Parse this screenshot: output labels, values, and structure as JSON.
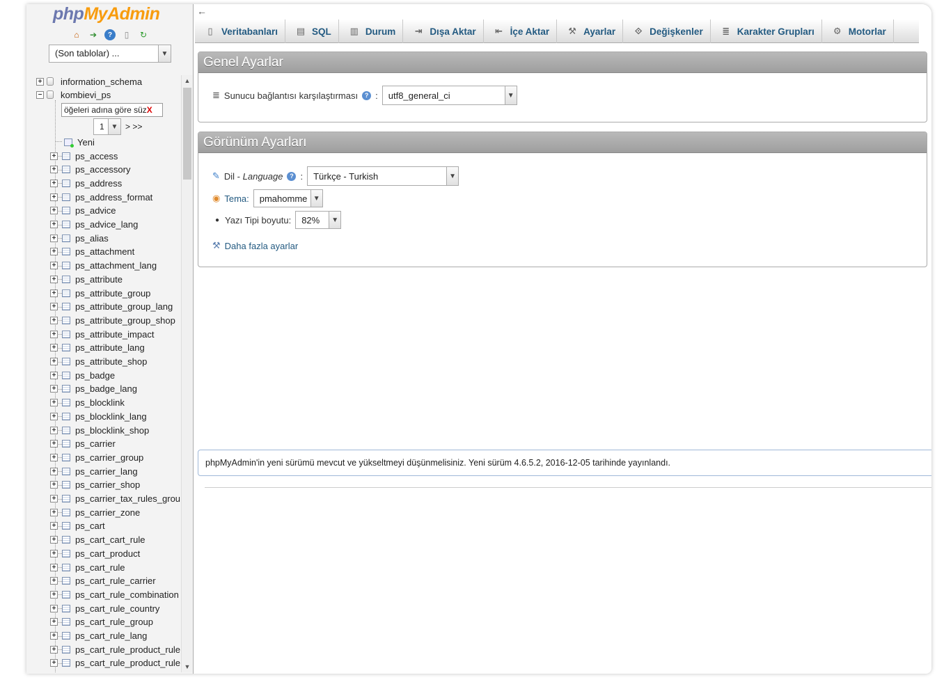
{
  "logo": {
    "php": "php",
    "my": "My",
    "admin": "Admin"
  },
  "nav": {
    "recent_select": "(Son tablolar) ...",
    "databases": [
      {
        "name": "information_schema",
        "expanded": false
      },
      {
        "name": "kombievi_ps",
        "expanded": true
      }
    ],
    "filter_placeholder": "öğeleri adına göre süz",
    "filter_clear": "X",
    "page_value": "1",
    "page_next": "> >>",
    "new_label": "Yeni",
    "tables": [
      "ps_access",
      "ps_accessory",
      "ps_address",
      "ps_address_format",
      "ps_advice",
      "ps_advice_lang",
      "ps_alias",
      "ps_attachment",
      "ps_attachment_lang",
      "ps_attribute",
      "ps_attribute_group",
      "ps_attribute_group_lang",
      "ps_attribute_group_shop",
      "ps_attribute_impact",
      "ps_attribute_lang",
      "ps_attribute_shop",
      "ps_badge",
      "ps_badge_lang",
      "ps_blocklink",
      "ps_blocklink_lang",
      "ps_blocklink_shop",
      "ps_carrier",
      "ps_carrier_group",
      "ps_carrier_lang",
      "ps_carrier_shop",
      "ps_carrier_tax_rules_grou",
      "ps_carrier_zone",
      "ps_cart",
      "ps_cart_cart_rule",
      "ps_cart_product",
      "ps_cart_rule",
      "ps_cart_rule_carrier",
      "ps_cart_rule_combination",
      "ps_cart_rule_country",
      "ps_cart_rule_group",
      "ps_cart_rule_lang",
      "ps_cart_rule_product_rule",
      "ps_cart_rule_product_rule"
    ]
  },
  "tabs": [
    {
      "label": "Veritabanları",
      "icon": "database-icon",
      "glyph": "▯"
    },
    {
      "label": "SQL",
      "icon": "sql-icon",
      "glyph": "▤"
    },
    {
      "label": "Durum",
      "icon": "status-icon",
      "glyph": "▥"
    },
    {
      "label": "Dışa Aktar",
      "icon": "export-icon",
      "glyph": "⇥"
    },
    {
      "label": "İçe Aktar",
      "icon": "import-icon",
      "glyph": "⇤"
    },
    {
      "label": "Ayarlar",
      "icon": "wrench-icon",
      "glyph": "⚒"
    },
    {
      "label": "Değişkenler",
      "icon": "variables-icon",
      "glyph": "⟐"
    },
    {
      "label": "Karakter Grupları",
      "icon": "charset-icon",
      "glyph": "≣"
    },
    {
      "label": "Motorlar",
      "icon": "engine-icon",
      "glyph": "⚙"
    }
  ],
  "general": {
    "title": "Genel Ayarlar",
    "collation_label": "Sunucu bağlantısı karşılaştırması",
    "collation_value": "utf8_general_ci"
  },
  "appearance": {
    "title": "Görünüm Ayarları",
    "language_label": "Dil - ",
    "language_label_en": "Language",
    "language_value": "Türkçe - Turkish",
    "theme_label": "Tema:",
    "theme_value": "pmahomme",
    "font_label": "Yazı Tipi boyutu:",
    "font_value": "82%",
    "more_settings": "Daha fazla ayarlar"
  },
  "notice": "phpMyAdmin'in yeni sürümü mevcut ve yükseltmeyi düşünmelisiniz. Yeni sürüm 4.6.5.2, 2016-12-05 tarihinde yayınlandı.",
  "colors": {
    "link": "#235a81",
    "panel_header": "#9e9e9e",
    "logo_php": "#6c78af",
    "logo_myadmin": "#f89c0e"
  }
}
